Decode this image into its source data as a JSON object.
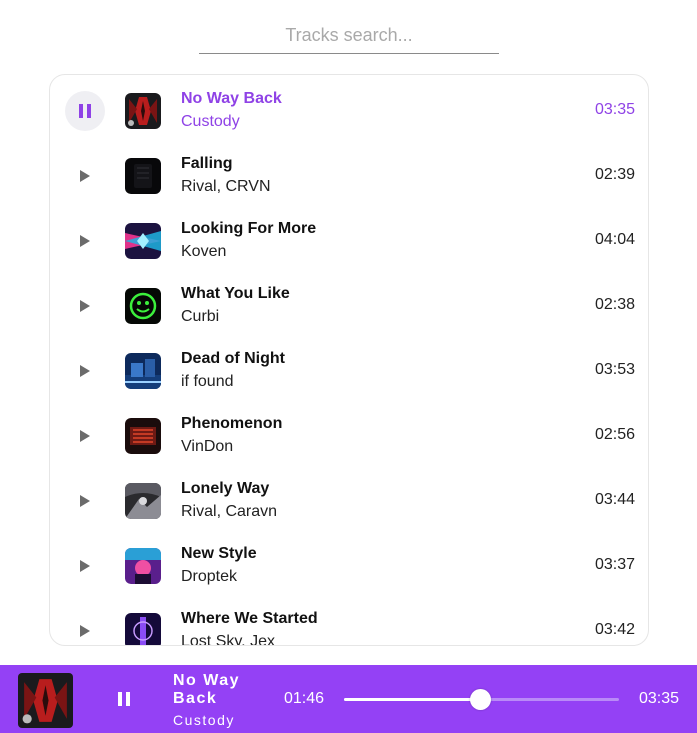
{
  "search": {
    "placeholder": "Tracks search...",
    "value": ""
  },
  "accent_color": "#9441f5",
  "tracks": [
    {
      "title": "No Way Back",
      "artist": "Custody",
      "duration": "03:35",
      "state": "playing",
      "control_icon": "pause-icon"
    },
    {
      "title": "Falling",
      "artist": "Rival, CRVN",
      "duration": "02:39",
      "state": "idle",
      "control_icon": "play-icon"
    },
    {
      "title": "Looking For More",
      "artist": "Koven",
      "duration": "04:04",
      "state": "idle",
      "control_icon": "play-icon"
    },
    {
      "title": "What You Like",
      "artist": "Curbi",
      "duration": "02:38",
      "state": "idle",
      "control_icon": "play-icon"
    },
    {
      "title": "Dead of Night",
      "artist": "if found",
      "duration": "03:53",
      "state": "idle",
      "control_icon": "play-icon"
    },
    {
      "title": "Phenomenon",
      "artist": "VinDon",
      "duration": "02:56",
      "state": "idle",
      "control_icon": "play-icon"
    },
    {
      "title": "Lonely Way",
      "artist": "Rival, Caravn",
      "duration": "03:44",
      "state": "idle",
      "control_icon": "play-icon"
    },
    {
      "title": "New Style",
      "artist": "Droptek",
      "duration": "03:37",
      "state": "idle",
      "control_icon": "play-icon"
    },
    {
      "title": "Where We Started",
      "artist": "Lost Sky, Jex",
      "duration": "03:42",
      "state": "idle",
      "control_icon": "play-icon"
    }
  ],
  "player": {
    "title": "No Way Back",
    "artist": "Custody",
    "current_time": "01:46",
    "total_time": "03:35",
    "progress": 0.493,
    "control_icon": "pause-icon"
  }
}
